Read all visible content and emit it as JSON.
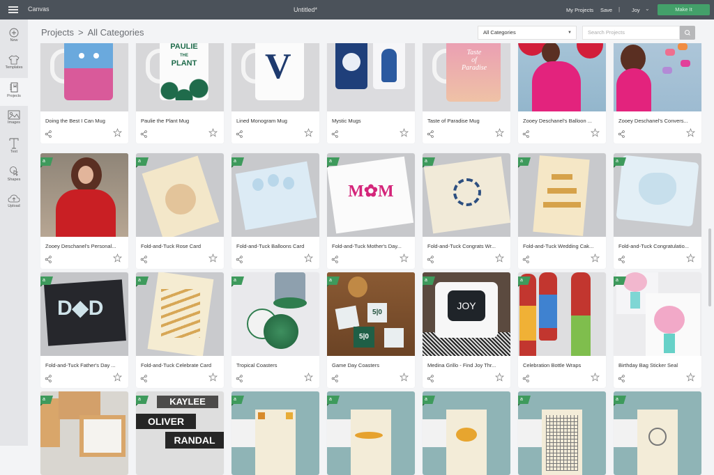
{
  "topbar": {
    "app_name": "Canvas",
    "doc_title": "Untitled*",
    "my_projects": "My Projects",
    "save": "Save",
    "separator": "|",
    "user": "Joy",
    "make_it": "Make It"
  },
  "sidebar": {
    "items": [
      {
        "label": "New",
        "icon": "plus-circle-icon"
      },
      {
        "label": "Templates",
        "icon": "tshirt-icon"
      },
      {
        "label": "Projects",
        "icon": "notebook-icon",
        "active": true
      },
      {
        "label": "Images",
        "icon": "image-icon"
      },
      {
        "label": "Text",
        "icon": "text-t-icon"
      },
      {
        "label": "Shapes",
        "icon": "shapes-icon"
      },
      {
        "label": "Upload",
        "icon": "cloud-upload-icon"
      }
    ]
  },
  "header": {
    "breadcrumb_root": "Projects",
    "breadcrumb_sep": ">",
    "breadcrumb_current": "All Categories",
    "category_select": "All Categories",
    "search_placeholder": "Search Projects"
  },
  "badge_text": "a",
  "accent_colors": {
    "topbar": "#4b525a",
    "make_it": "#43a06a",
    "badge": "#3e9a5c"
  },
  "projects": [
    [
      {
        "title": "Doing the Best I Can Mug",
        "bg": "#d9d9db",
        "art": "mug-pink-blue"
      },
      {
        "title": "Paulie the Plant Mug",
        "bg": "#d7d7d9",
        "art": "mug-plant"
      },
      {
        "title": "Lined Monogram Mug",
        "bg": "#d8d8da",
        "art": "mug-monogram"
      },
      {
        "title": "Mystic Mugs",
        "bg": "#dcdcdf",
        "art": "mug-mystic"
      },
      {
        "title": "Taste of Paradise Mug",
        "bg": "#d9d9dc",
        "art": "mug-paradise"
      },
      {
        "title": "Zooey Deschanel's Balloon ...",
        "bg": "#a9c6d9",
        "art": "photo-balloon"
      },
      {
        "title": "Zooey Deschanel's Convers...",
        "bg": "#b0c8da",
        "art": "photo-hearts"
      }
    ],
    [
      {
        "title": "Zooey Deschanel's Personal...",
        "bg": "#8b7a6b",
        "art": "photo-red"
      },
      {
        "title": "Fold-and-Tuck Rose Card",
        "bg": "#c9cacd",
        "art": "card-rose"
      },
      {
        "title": "Fold-and-Tuck Balloons Card",
        "bg": "#c8c9cc",
        "art": "card-balloons"
      },
      {
        "title": "Fold-and-Tuck Mother's Day...",
        "bg": "#c7c8cb",
        "art": "card-mom"
      },
      {
        "title": "Fold-and-Tuck Congrats Wr...",
        "bg": "#c6c7ca",
        "art": "card-congrats"
      },
      {
        "title": "Fold-and-Tuck Wedding Cak...",
        "bg": "#c8c9cc",
        "art": "card-wedding"
      },
      {
        "title": "Fold-and-Tuck Congratulatio...",
        "bg": "#c9cacd",
        "art": "card-heart"
      }
    ],
    [
      {
        "title": "Fold-and-Tuck Father's Day ...",
        "bg": "#c4c5c8",
        "art": "card-dad"
      },
      {
        "title": "Fold-and-Tuck Celebrate Card",
        "bg": "#c9cacd",
        "art": "card-celebrate"
      },
      {
        "title": "Tropical Coasters",
        "bg": "#e9e9ec",
        "art": "coasters-tropical"
      },
      {
        "title": "Game Day Coasters",
        "bg": "#8a5a33",
        "art": "coasters-gameday"
      },
      {
        "title": "Medina Grillo - Find Joy Thr...",
        "bg": "#5b4a3f",
        "art": "pillow-joy"
      },
      {
        "title": "Celebration Bottle Wraps",
        "bg": "#dedee0",
        "art": "bottles"
      },
      {
        "title": "Birthday Bag Sticker Seal",
        "bg": "#ececee",
        "art": "bag-seal"
      }
    ],
    [
      {
        "title": "",
        "bg": "#d9d6d0",
        "art": "boxes-thankyou"
      },
      {
        "title": "",
        "bg": "#dedede",
        "art": "name-labels"
      },
      {
        "title": "",
        "bg": "#8fb4b6",
        "art": "card-popcorn"
      },
      {
        "title": "",
        "bg": "#8fb4b6",
        "art": "card-pepper"
      },
      {
        "title": "",
        "bg": "#8fb4b6",
        "art": "card-butterfly"
      },
      {
        "title": "",
        "bg": "#8fb4b6",
        "art": "card-plaid"
      },
      {
        "title": "",
        "bg": "#8fb4b6",
        "art": "card-lock"
      }
    ]
  ]
}
